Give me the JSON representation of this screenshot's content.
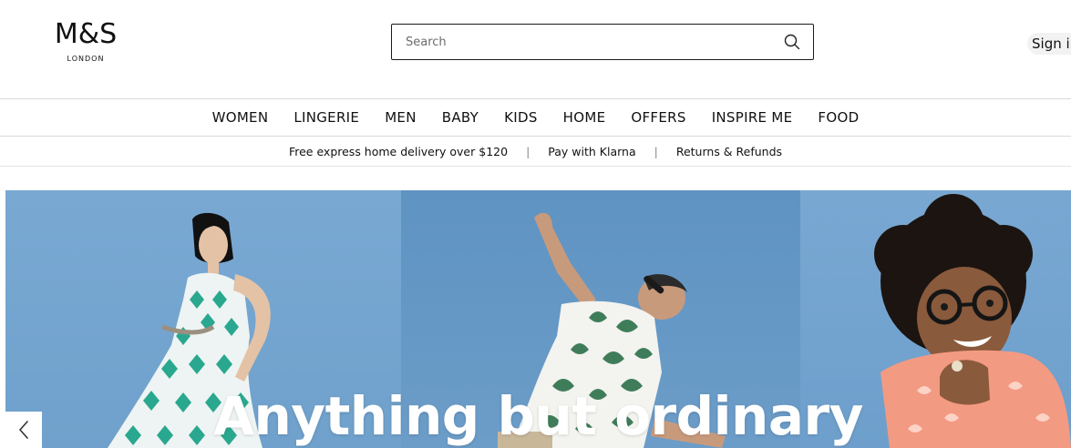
{
  "brand": {
    "name": "M&S",
    "tagline": "LONDON"
  },
  "search": {
    "placeholder": "Search",
    "icon": "search-icon"
  },
  "account": {
    "signin_label": "Sign in"
  },
  "nav": {
    "items": [
      {
        "label": "WOMEN"
      },
      {
        "label": "LINGERIE"
      },
      {
        "label": "MEN"
      },
      {
        "label": "BABY"
      },
      {
        "label": "KIDS"
      },
      {
        "label": "HOME"
      },
      {
        "label": "OFFERS"
      },
      {
        "label": "INSPIRE ME"
      },
      {
        "label": "FOOD"
      }
    ]
  },
  "infobar": {
    "items": [
      {
        "label": "Free express home delivery over $120"
      },
      {
        "label": "Pay with Klarna"
      },
      {
        "label": "Returns & Refunds"
      }
    ],
    "separator": "|"
  },
  "hero": {
    "title": "Anything but ordinary",
    "prev_icon": "chevron-left-icon"
  },
  "colors": {
    "hero_blue": "#6fa1cc",
    "text": "#111111",
    "border": "#d9d9d9"
  }
}
